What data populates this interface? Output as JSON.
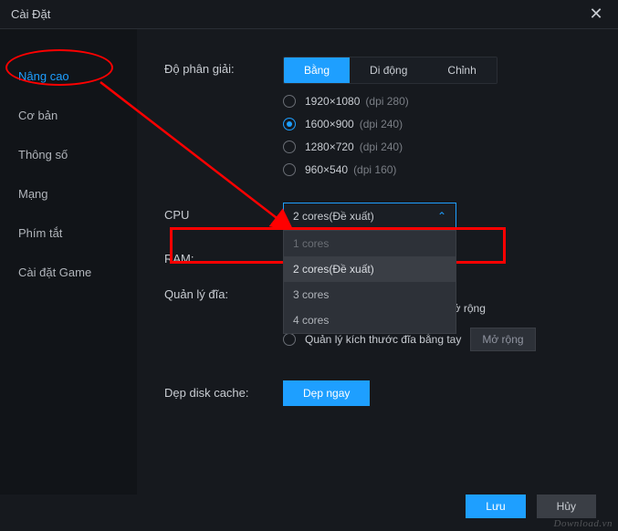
{
  "window": {
    "title": "Cài Đặt"
  },
  "sidebar": {
    "items": [
      {
        "label": "Nâng cao",
        "active": true
      },
      {
        "label": "Cơ bản"
      },
      {
        "label": "Thông số"
      },
      {
        "label": "Mạng"
      },
      {
        "label": "Phím tắt"
      },
      {
        "label": "Cài đặt Game"
      }
    ]
  },
  "resolution": {
    "label": "Độ phân giải:",
    "tabs": [
      {
        "label": "Bằng",
        "active": true
      },
      {
        "label": "Di động"
      },
      {
        "label": "Chỉnh"
      }
    ],
    "options": [
      {
        "res": "1920×1080",
        "dpi": "(dpi 280)",
        "checked": false
      },
      {
        "res": "1600×900",
        "dpi": "(dpi 240)",
        "checked": true
      },
      {
        "res": "1280×720",
        "dpi": "(dpi 240)",
        "checked": false
      },
      {
        "res": "960×540",
        "dpi": "(dpi 160)",
        "checked": false
      }
    ]
  },
  "cpu": {
    "label": "CPU",
    "value": "2 cores(Đề xuất)",
    "options": [
      {
        "label": "1 cores",
        "dim": true
      },
      {
        "label": "2 cores(Đề xuất)",
        "sel": true
      },
      {
        "label": "3 cores"
      },
      {
        "label": "4 cores"
      }
    ]
  },
  "ram": {
    "label": "RAM:"
  },
  "disk": {
    "label": "Quản lý đĩa:",
    "auto_label": "Không đủ thời gian, tự động mở rộng",
    "manual_label": "Quản lý kích thước đĩa bằng tay",
    "expand_btn": "Mở rộng"
  },
  "cache": {
    "label": "Dẹp disk cache:",
    "btn": "Dẹp ngay"
  },
  "footer": {
    "save": "Lưu",
    "cancel": "Hủy"
  },
  "watermark": "Download.vn"
}
